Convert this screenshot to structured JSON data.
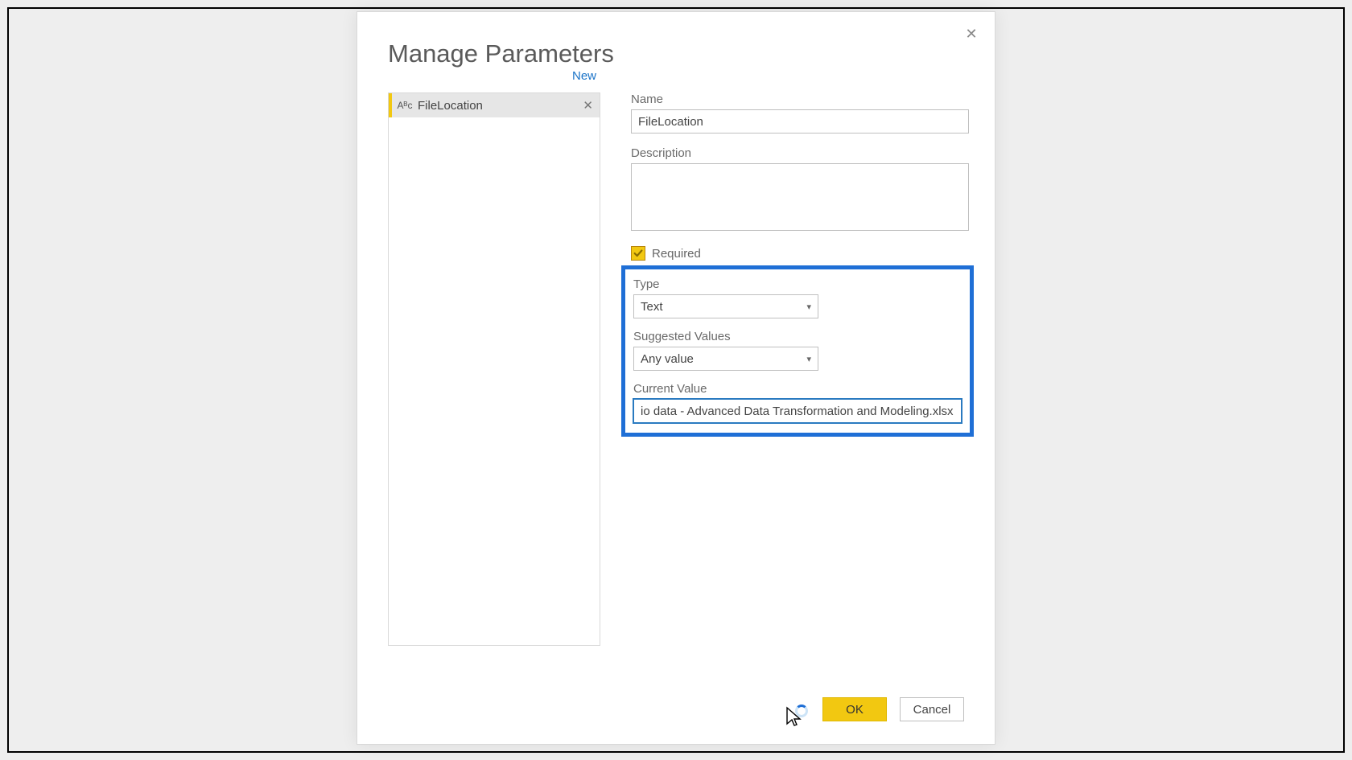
{
  "dialog": {
    "title": "Manage Parameters",
    "new_label": "New",
    "close_glyph": "✕"
  },
  "parameter_list": [
    {
      "type_icon": "Aᴮc",
      "name": "FileLocation",
      "delete_glyph": "✕"
    }
  ],
  "form": {
    "name_label": "Name",
    "name_value": "FileLocation",
    "description_label": "Description",
    "description_value": "",
    "required_label": "Required",
    "required_checked": true,
    "type_label": "Type",
    "type_value": "Text",
    "suggested_label": "Suggested Values",
    "suggested_value": "Any value",
    "current_value_label": "Current Value",
    "current_value": "io data - Advanced Data Transformation and Modeling.xlsx"
  },
  "buttons": {
    "ok": "OK",
    "cancel": "Cancel"
  },
  "colors": {
    "accent": "#f2c811",
    "highlight": "#1f6fd6"
  }
}
